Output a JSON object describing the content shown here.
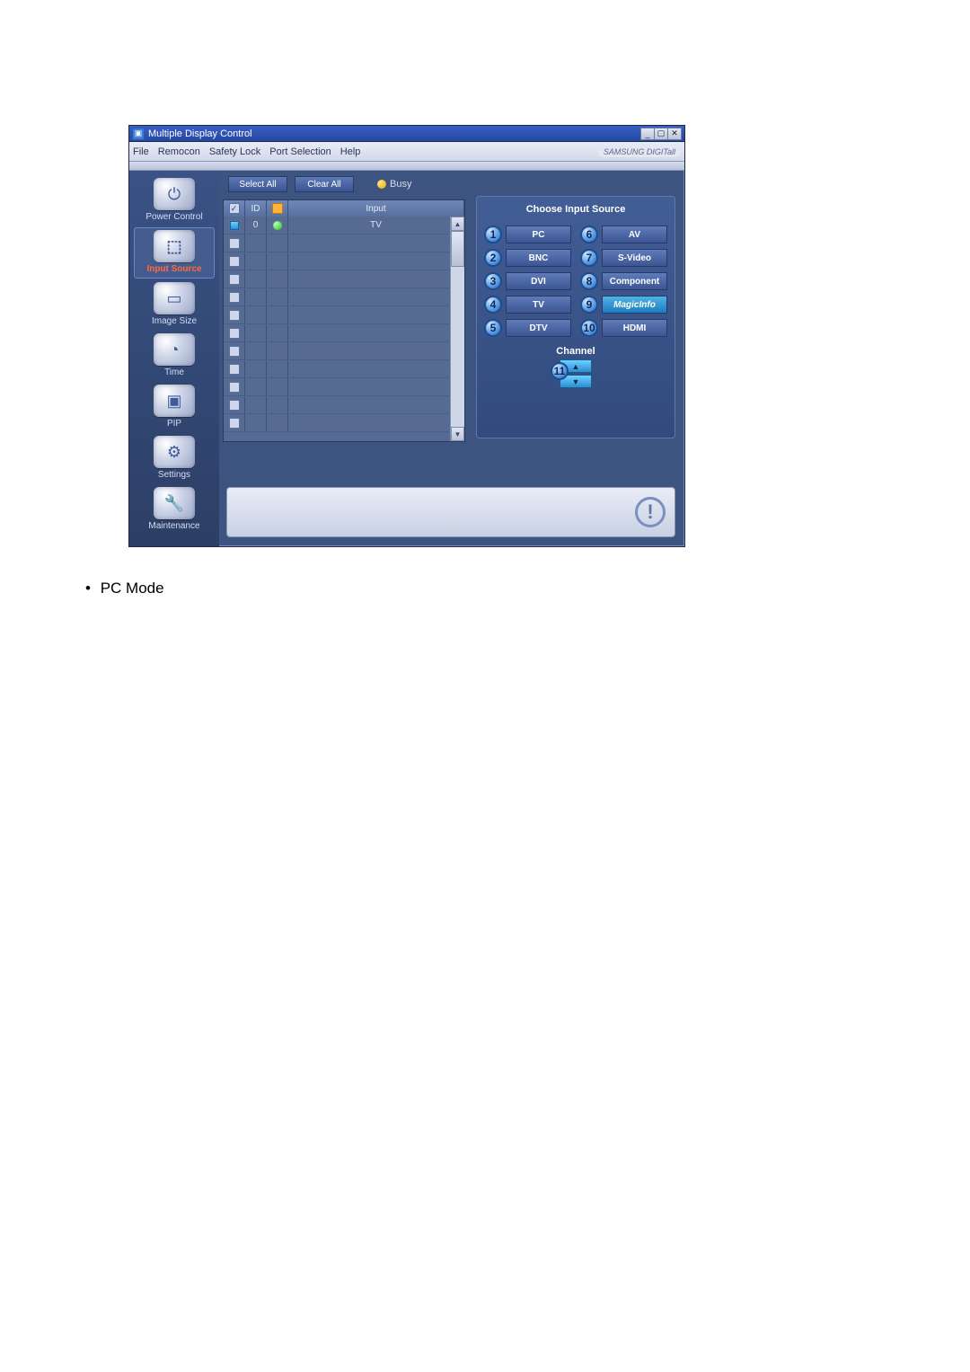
{
  "titlebar": {
    "title": "Multiple Display Control"
  },
  "menu": {
    "file": "File",
    "remocon": "Remocon",
    "safety_lock": "Safety Lock",
    "port_selection": "Port Selection",
    "help": "Help",
    "brand": "SAMSUNG DIGITall"
  },
  "sidebar": {
    "items": [
      {
        "label": "Power Control"
      },
      {
        "label": "Input Source"
      },
      {
        "label": "Image Size"
      },
      {
        "label": "Time"
      },
      {
        "label": "PIP"
      },
      {
        "label": "Settings"
      },
      {
        "label": "Maintenance"
      }
    ]
  },
  "center": {
    "select_all": "Select All",
    "clear_all": "Clear All",
    "busy": "Busy",
    "columns": {
      "id": "ID",
      "input": "Input"
    },
    "rows": [
      {
        "checked": true,
        "id": "0",
        "status": "on",
        "input": "TV"
      },
      {
        "checked": false,
        "id": "",
        "status": "",
        "input": ""
      },
      {
        "checked": false,
        "id": "",
        "status": "",
        "input": ""
      },
      {
        "checked": false,
        "id": "",
        "status": "",
        "input": ""
      },
      {
        "checked": false,
        "id": "",
        "status": "",
        "input": ""
      },
      {
        "checked": false,
        "id": "",
        "status": "",
        "input": ""
      },
      {
        "checked": false,
        "id": "",
        "status": "",
        "input": ""
      },
      {
        "checked": false,
        "id": "",
        "status": "",
        "input": ""
      },
      {
        "checked": false,
        "id": "",
        "status": "",
        "input": ""
      },
      {
        "checked": false,
        "id": "",
        "status": "",
        "input": ""
      },
      {
        "checked": false,
        "id": "",
        "status": "",
        "input": ""
      },
      {
        "checked": false,
        "id": "",
        "status": "",
        "input": ""
      }
    ]
  },
  "right": {
    "title": "Choose Input Source",
    "sources": [
      {
        "n": "1",
        "label": "PC"
      },
      {
        "n": "2",
        "label": "BNC"
      },
      {
        "n": "3",
        "label": "DVI"
      },
      {
        "n": "4",
        "label": "TV"
      },
      {
        "n": "5",
        "label": "DTV"
      },
      {
        "n": "6",
        "label": "AV"
      },
      {
        "n": "7",
        "label": "S-Video"
      },
      {
        "n": "8",
        "label": "Component"
      },
      {
        "n": "9",
        "label": "MagicInfo"
      },
      {
        "n": "10",
        "label": "HDMI"
      }
    ],
    "channel_label": "Channel",
    "channel_badge": "11"
  },
  "caption": {
    "bullet": "•",
    "text": "PC Mode"
  }
}
